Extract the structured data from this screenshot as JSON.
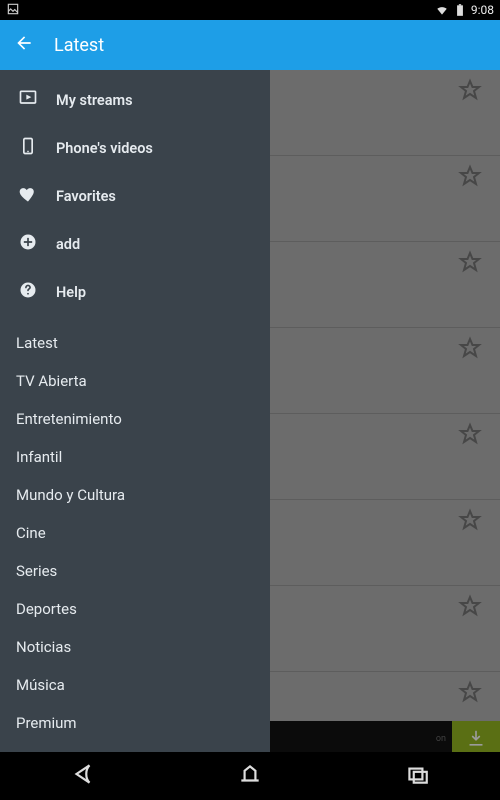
{
  "status": {
    "time": "9:08"
  },
  "appbar": {
    "title": "Latest"
  },
  "drawer": {
    "primary": [
      {
        "icon": "play-monitor-icon",
        "label": "My streams"
      },
      {
        "icon": "phone-icon",
        "label": "Phone's videos"
      },
      {
        "icon": "heart-icon",
        "label": "Favorites"
      },
      {
        "icon": "plus-circle-icon",
        "label": "add"
      },
      {
        "icon": "help-icon",
        "label": "Help"
      }
    ],
    "categories": [
      "Latest",
      "TV Abierta",
      "Entretenimiento",
      "Infantil",
      "Mundo y Cultura",
      "Cine",
      "Series",
      "Deportes",
      "Noticias",
      "Música",
      "Premium"
    ]
  },
  "content": {
    "rows": [
      {
        "favorited": false
      },
      {
        "favorited": false
      },
      {
        "favorited": false
      },
      {
        "favorited": false
      },
      {
        "favorited": false
      },
      {
        "favorited": false
      },
      {
        "favorited": false
      },
      {
        "favorited": false
      }
    ],
    "ad_hint": "on"
  }
}
